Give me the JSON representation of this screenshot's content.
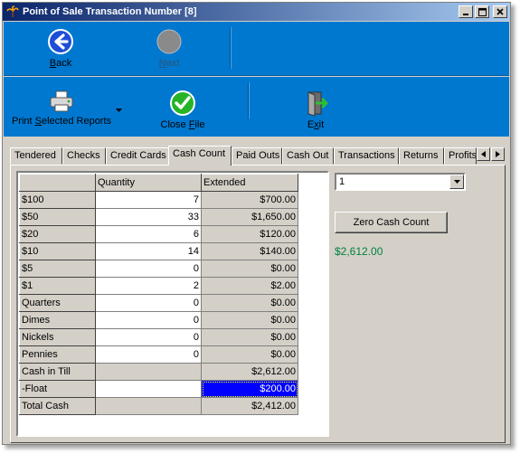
{
  "window": {
    "title": "Point of Sale Transaction Number [8]",
    "colors": {
      "titlebar": "#0a246a",
      "toolbar": "#0078d0",
      "selection": "#0000ff",
      "total_text": "#008040"
    }
  },
  "toolbar": {
    "back": {
      "prefix": "",
      "hotkey": "B",
      "suffix": "ack",
      "icon": "back-arrow-icon"
    },
    "next": {
      "prefix": "",
      "hotkey": "N",
      "suffix": "ext",
      "icon": "next-circle-icon"
    },
    "print": {
      "prefix": "Print ",
      "hotkey": "S",
      "suffix": "elected Reports",
      "icon": "printer-icon"
    },
    "close_file": {
      "prefix": "Close ",
      "hotkey": "F",
      "suffix": "ile",
      "icon": "checkmark-icon"
    },
    "exit": {
      "prefix": "E",
      "hotkey": "x",
      "suffix": "it",
      "icon": "exit-door-icon"
    }
  },
  "tabs": [
    "Tendered",
    "Checks",
    "Credit Cards",
    "Cash Count",
    "Paid Outs",
    "Cash Out",
    "Transactions",
    "Returns",
    "Profits"
  ],
  "active_tab": "Cash Count",
  "grid": {
    "headers": [
      "",
      "Quantity",
      "Extended"
    ],
    "rows": [
      {
        "label": "$100",
        "qty": "7",
        "ext": "$700.00"
      },
      {
        "label": "$50",
        "qty": "33",
        "ext": "$1,650.00"
      },
      {
        "label": "$20",
        "qty": "6",
        "ext": "$120.00"
      },
      {
        "label": "$10",
        "qty": "14",
        "ext": "$140.00"
      },
      {
        "label": "$5",
        "qty": "0",
        "ext": "$0.00"
      },
      {
        "label": "$1",
        "qty": "2",
        "ext": "$2.00"
      },
      {
        "label": "Quarters",
        "qty": "0",
        "ext": "$0.00"
      },
      {
        "label": "Dimes",
        "qty": "0",
        "ext": "$0.00"
      },
      {
        "label": "Nickels",
        "qty": "0",
        "ext": "$0.00"
      },
      {
        "label": "Pennies",
        "qty": "0",
        "ext": "$0.00"
      }
    ],
    "cash_in_till": {
      "label": "Cash in Till",
      "ext": "$2,612.00"
    },
    "float": {
      "label": "-Float",
      "ext": "$200.00"
    },
    "total_cash": {
      "label": "Total Cash",
      "ext": "$2,412.00"
    }
  },
  "side": {
    "register_select": "1",
    "zero_button": "Zero Cash Count",
    "total": "$2,612.00"
  }
}
